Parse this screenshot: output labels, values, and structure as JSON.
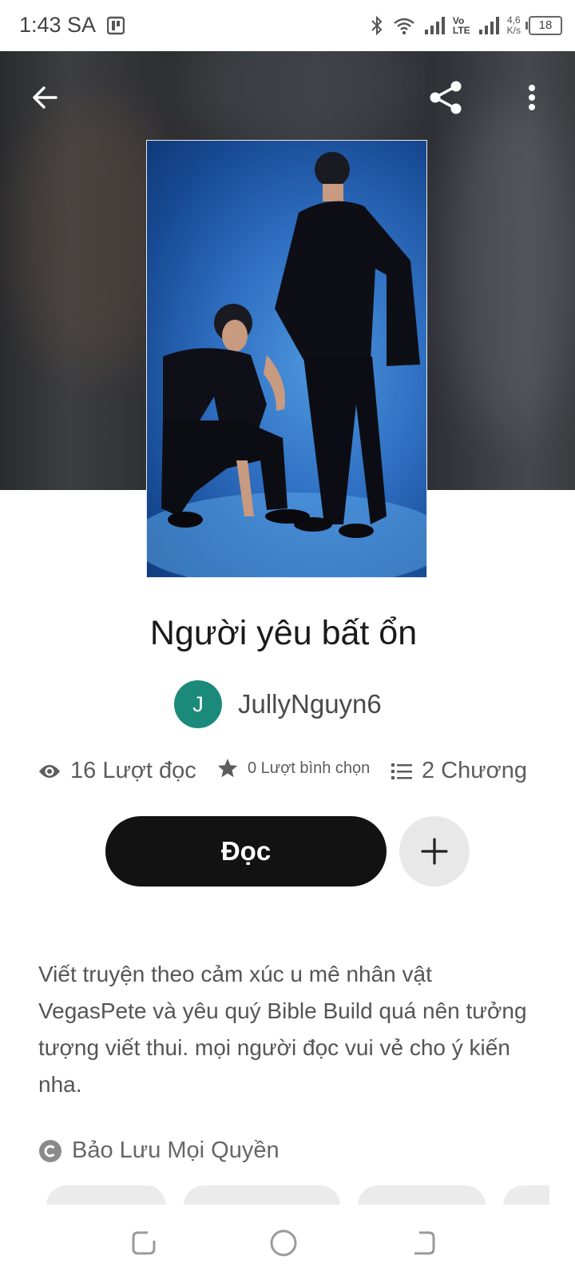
{
  "status_bar": {
    "time": "1:43 SA",
    "lte_top": "Vo",
    "lte_bottom": "LTE",
    "speed_value": "4,6",
    "speed_unit": "K/s",
    "battery": "18"
  },
  "story": {
    "title": "Người yêu bất ổn",
    "author_initial": "J",
    "author_name": "JullyNguyn6"
  },
  "stats": {
    "reads": "16 Lượt đọc",
    "votes": "0 Lượt bình chọn",
    "chapters": "2 Chương"
  },
  "actions": {
    "read_label": "Đọc"
  },
  "description": "Viết truyện theo cảm xúc u mê nhân vật VegasPete và yêu quý Bible Build quá nên tưởng tượng viết thui. mọi người đọc vui vẻ cho ý kiến nha.",
  "copyright": "Bảo Lưu Mọi Quyền",
  "colors": {
    "avatar": "#1b8a7a",
    "read_button": "#121212",
    "add_button": "#e8e8e8"
  },
  "icons": [
    "back-arrow-icon",
    "share-icon",
    "more-vert-icon",
    "eye-icon",
    "star-icon",
    "list-icon",
    "plus-icon",
    "copyright-icon",
    "recent-apps-icon",
    "home-icon",
    "back-nav-icon"
  ]
}
